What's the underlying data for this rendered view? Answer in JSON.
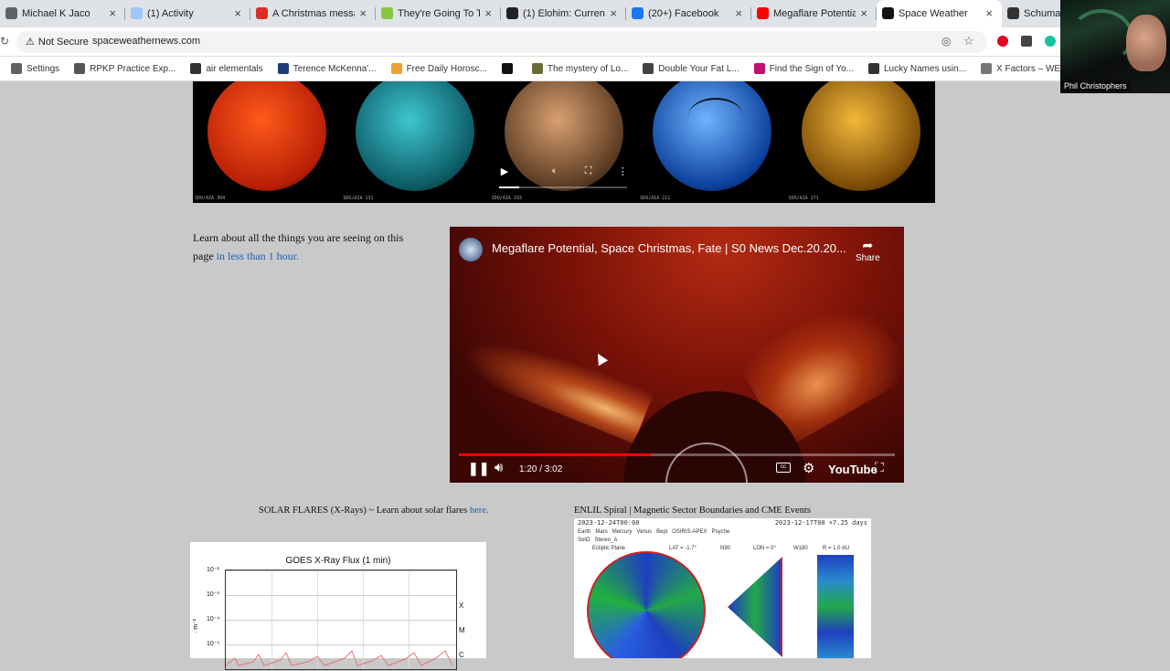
{
  "tabs": [
    {
      "label": "Michael K Jaco",
      "icon": "tab-favicon",
      "color": "#5f6368"
    },
    {
      "label": "(1) Activity",
      "icon": "tab-favicon",
      "color": "#a0c4ff"
    },
    {
      "label": "A Christmas messa",
      "icon": "gmail-icon",
      "color": "#d93025"
    },
    {
      "label": "They're Going To Ta",
      "icon": "rumble-icon",
      "color": "#85c742"
    },
    {
      "label": "(1) Elohim: Current",
      "icon": "tab-favicon",
      "color": "#222222"
    },
    {
      "label": "(20+) Facebook",
      "icon": "facebook-icon",
      "color": "#1877f2"
    },
    {
      "label": "Megaflare Potential",
      "icon": "youtube-icon",
      "color": "#ff0000"
    },
    {
      "label": "Space Weather",
      "icon": "tab-favicon",
      "color": "#111111",
      "active": true
    },
    {
      "label": "Schumann",
      "icon": "tab-favicon",
      "color": "#333333"
    }
  ],
  "address": {
    "security_label": "Not Secure",
    "url": "spaceweathernews.com"
  },
  "bookmarks": [
    {
      "label": "Settings",
      "color": "#5f6368"
    },
    {
      "label": "RPKP Practice Exp...",
      "color": "#555555"
    },
    {
      "label": "air elementals",
      "color": "#333333"
    },
    {
      "label": "Terence McKenna'...",
      "color": "#1c3d7a"
    },
    {
      "label": "Free Daily Horosc...",
      "color": "#f0a030"
    },
    {
      "label": "",
      "color": "#111111"
    },
    {
      "label": "The mystery of Lo...",
      "color": "#6b6b3a"
    },
    {
      "label": "Double Your Fat L...",
      "color": "#444444"
    },
    {
      "label": "Find the Sign of Yo...",
      "color": "#c01070"
    },
    {
      "label": "Lucky Names usin...",
      "color": "#333333"
    },
    {
      "label": "X Factors – WEF R...",
      "color": "#777777"
    }
  ],
  "webcam": {
    "name": "Phil Christophers"
  },
  "sun_images": [
    {
      "label": "SDO/AIA 304",
      "colors": [
        "#ff5a1a",
        "#b81e05"
      ]
    },
    {
      "label": "SDO/AIA 131",
      "colors": [
        "#3fc6d0",
        "#0b5a64"
      ]
    },
    {
      "label": "SDO/AIA 193",
      "colors": [
        "#d9a070",
        "#5a3a22"
      ]
    },
    {
      "label": "SDO/AIA 211",
      "colors": [
        "#6fb4ff",
        "#0b3f9a"
      ]
    },
    {
      "label": "SDO/AIA 171",
      "colors": [
        "#f2b83a",
        "#7a4a05"
      ]
    }
  ],
  "learn": {
    "text_before": "Learn about all the things you are seeing on this page ",
    "link": "in less than 1 hour."
  },
  "video": {
    "title": "Megaflare Potential, Space Christmas, Fate | S0 News Dec.20.20...",
    "share_label": "Share",
    "time": "1:20 / 3:02",
    "progress": 0.44,
    "buffered": 0.44,
    "youtube_label": "YouTube"
  },
  "solar_flares": {
    "caption": "SOLAR FLARES (X-Rays) ~ Learn about solar flares ",
    "link": "here.",
    "chart_title": "GOES X-Ray Flux (1 min)",
    "y_ticks": [
      "10⁻²",
      "10⁻³",
      "10⁻⁴",
      "10⁻⁵"
    ],
    "classes": [
      "X",
      "M",
      "C"
    ],
    "y_unit": "· m⁻²"
  },
  "enlil": {
    "caption": "ENLIL Spiral | Magnetic Sector Boundaries and CME Events",
    "header_left": "2023-12-24T00:00",
    "header_right": "2023-12-17T00 +7.25 days",
    "legend": [
      "Earth",
      "Mars",
      "Mercury",
      "Venus",
      "Bepi",
      "OSIRIS-APEX",
      "Psyche",
      "SolO",
      "Stereo_A"
    ],
    "labels": [
      "Ecliptic Plane",
      "LAT = -1.7°",
      "N90",
      "LON = 0°",
      "W180",
      "R = 1.0 AU"
    ]
  }
}
